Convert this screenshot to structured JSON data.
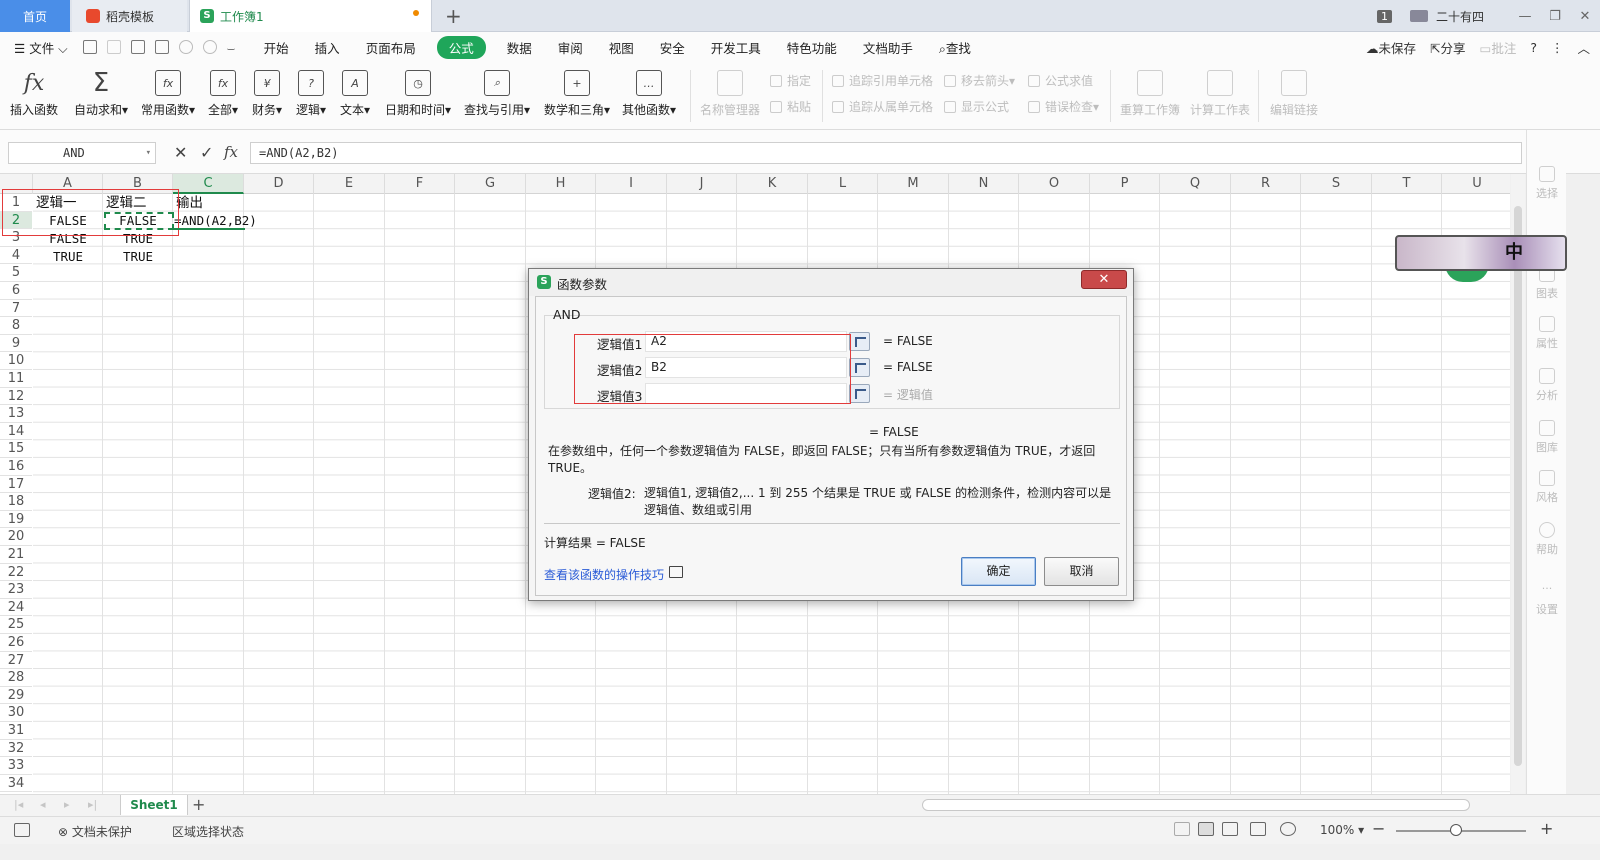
{
  "titlebar": {
    "tabs": [
      {
        "label": "首页"
      },
      {
        "label": "稻壳模板"
      },
      {
        "label": "工作簿1"
      }
    ],
    "new_tab": "+",
    "page_count": "1",
    "user_name": "二十有四",
    "window_buttons": [
      "—",
      "❐",
      "✕"
    ]
  },
  "menubar": {
    "file": "文件",
    "items": [
      "开始",
      "插入",
      "页面布局",
      "公式",
      "数据",
      "审阅",
      "视图",
      "安全",
      "开发工具",
      "特色功能",
      "文档助手",
      "查找"
    ],
    "active": "公式",
    "right": {
      "unsaved": "未保存",
      "share": "分享",
      "comment": "批注",
      "help": "?",
      "more": "⋮",
      "collapse": "︿"
    }
  },
  "ribbon": {
    "buttons": [
      {
        "label": "插入函数",
        "icon": "fx-icon"
      },
      {
        "label": "自动求和",
        "icon": "sigma-icon"
      },
      {
        "label": "常用函数",
        "icon": "function-icon"
      },
      {
        "label": "全部",
        "icon": "function-all-icon"
      },
      {
        "label": "财务",
        "icon": "finance-icon"
      },
      {
        "label": "逻辑",
        "icon": "logic-icon"
      },
      {
        "label": "文本",
        "icon": "text-icon"
      },
      {
        "label": "日期和时间",
        "icon": "clock-icon"
      },
      {
        "label": "查找与引用",
        "icon": "lookup-icon"
      },
      {
        "label": "数学和三角",
        "icon": "math-icon"
      },
      {
        "label": "其他函数",
        "icon": "other-icon"
      },
      {
        "label": "名称管理器",
        "icon": "name-manager-icon"
      },
      {
        "label": "重算工作簿",
        "icon": "recalc-workbook-icon"
      },
      {
        "label": "计算工作表",
        "icon": "calc-sheet-icon"
      },
      {
        "label": "编辑链接",
        "icon": "edit-link-icon"
      }
    ],
    "small": [
      "指定",
      "粘贴",
      "追踪引用单元格",
      "追踪从属单元格",
      "移去箭头",
      "显示公式",
      "公式求值",
      "错误检查"
    ]
  },
  "formula_bar": {
    "name_box": "AND",
    "formula": "=AND(A2,B2)"
  },
  "grid": {
    "columns": [
      "A",
      "B",
      "C",
      "D",
      "E",
      "F",
      "G",
      "H",
      "I",
      "J",
      "K",
      "L",
      "M",
      "N",
      "O",
      "P",
      "Q",
      "R",
      "S",
      "T",
      "U"
    ],
    "rows": [
      "1",
      "2",
      "3",
      "4",
      "5",
      "6",
      "7",
      "8",
      "9",
      "10",
      "11",
      "12",
      "13",
      "14",
      "15",
      "16",
      "17",
      "18",
      "19",
      "20",
      "21",
      "22",
      "23",
      "24",
      "25",
      "26",
      "27",
      "28",
      "29",
      "30",
      "31",
      "32",
      "33",
      "34"
    ],
    "cells": {
      "A1": "逻辑一",
      "B1": "逻辑二",
      "C1": "输出",
      "A2": "FALSE",
      "B2": "FALSE",
      "C2": "=AND(A2,B2)",
      "A3": "FALSE",
      "B3": "TRUE",
      "A4": "TRUE",
      "B4": "TRUE"
    }
  },
  "dialog": {
    "title": "函数参数",
    "close": "✕",
    "function_name": "AND",
    "args": [
      {
        "label": "逻辑值1",
        "value": "A2",
        "result": "=  FALSE"
      },
      {
        "label": "逻辑值2",
        "value": "B2",
        "result": "=  FALSE"
      },
      {
        "label": "逻辑值3",
        "value": "",
        "result": "=  逻辑值"
      }
    ],
    "overall_result": "=  FALSE",
    "description": "在参数组中，任何一个参数逻辑值为 FALSE，即返回 FALSE；只有当所有参数逻辑值为 TRUE，才返回 TRUE。",
    "arg_desc_label": "逻辑值2:",
    "arg_desc": "逻辑值1, 逻辑值2,... 1 到 255 个结果是 TRUE 或 FALSE 的检测条件，检测内容可以是逻辑值、数组或引用",
    "calc_result": "计算结果  =  FALSE",
    "help_link": "查看该函数的操作技巧",
    "ok": "确定",
    "cancel": "取消"
  },
  "sidebar": {
    "items": [
      "选择",
      "图表",
      "属性",
      "分析",
      "图库",
      "风格",
      "帮助",
      "设置"
    ]
  },
  "float_widget": {
    "ime": "中"
  },
  "sheetbar": {
    "sheet_name": "Sheet1",
    "add": "+"
  },
  "statusbar": {
    "protect": "文档未保护",
    "region": "区域选择状态",
    "zoom": "100%",
    "zoom_fraction": 0.46
  }
}
